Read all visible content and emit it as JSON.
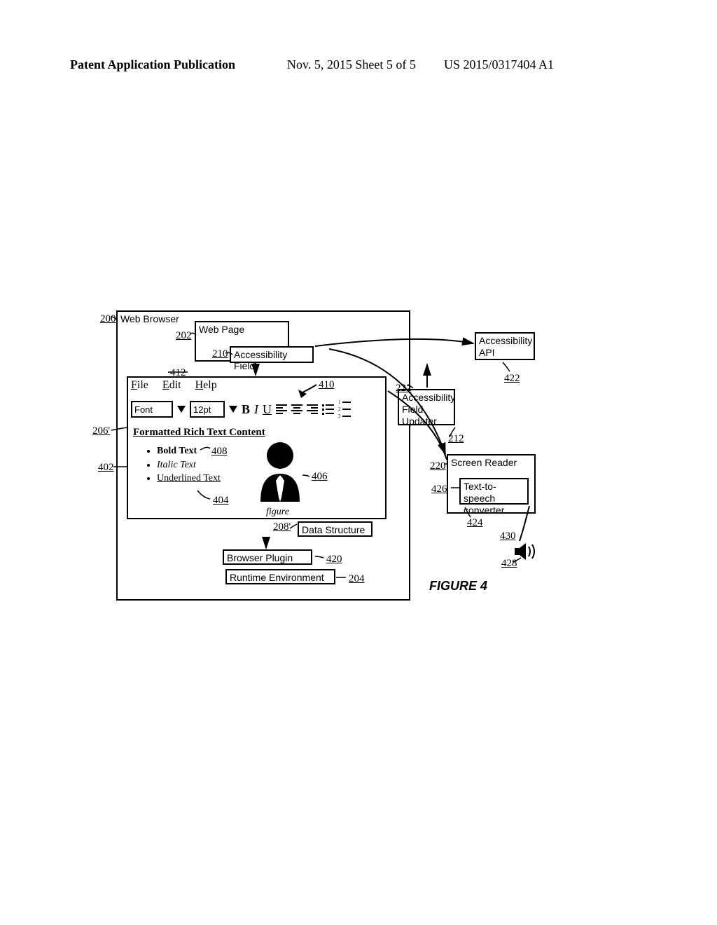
{
  "header": {
    "left": "Patent Application Publication",
    "mid": "Nov. 5, 2015  Sheet 5 of 5",
    "right": "US 2015/0317404 A1"
  },
  "labels": {
    "web_browser": "Web Browser",
    "web_page": "Web Page",
    "accessibility_field": "Accessibility Field",
    "data_structure": "Data Structure",
    "browser_plugin": "Browser Plugin",
    "runtime_env": "Runtime Environment",
    "accessibility_api": "Accessibility API",
    "field_updater": "Accessibility Field Updater",
    "screen_reader": "Screen Reader",
    "tts": "Text-to-speech converter",
    "figure_label": "FIGURE 4",
    "avatar_caption": "figure"
  },
  "menu": {
    "file": "File",
    "edit": "Edit",
    "help": "Help"
  },
  "toolbar": {
    "font_label": "Font",
    "size": "12pt",
    "bold": "B",
    "italic": "I",
    "underline": "U"
  },
  "content": {
    "heading": "Formatted Rich Text Content",
    "b1": "Bold Text",
    "b2": "Italic Text",
    "b3": "Underlined Text"
  },
  "refs": {
    "r200": "200",
    "r202": "202",
    "r210": "210",
    "r412": "412",
    "r410": "410",
    "r206": "206'",
    "r402": "402",
    "r408": "408",
    "r406": "406",
    "r404": "404",
    "r208": "208'",
    "r420": "420",
    "r204": "204",
    "r222": "222",
    "r212": "212",
    "r220": "220",
    "r426": "426",
    "r424": "424",
    "r430": "430",
    "r428": "428",
    "r422": "422"
  }
}
